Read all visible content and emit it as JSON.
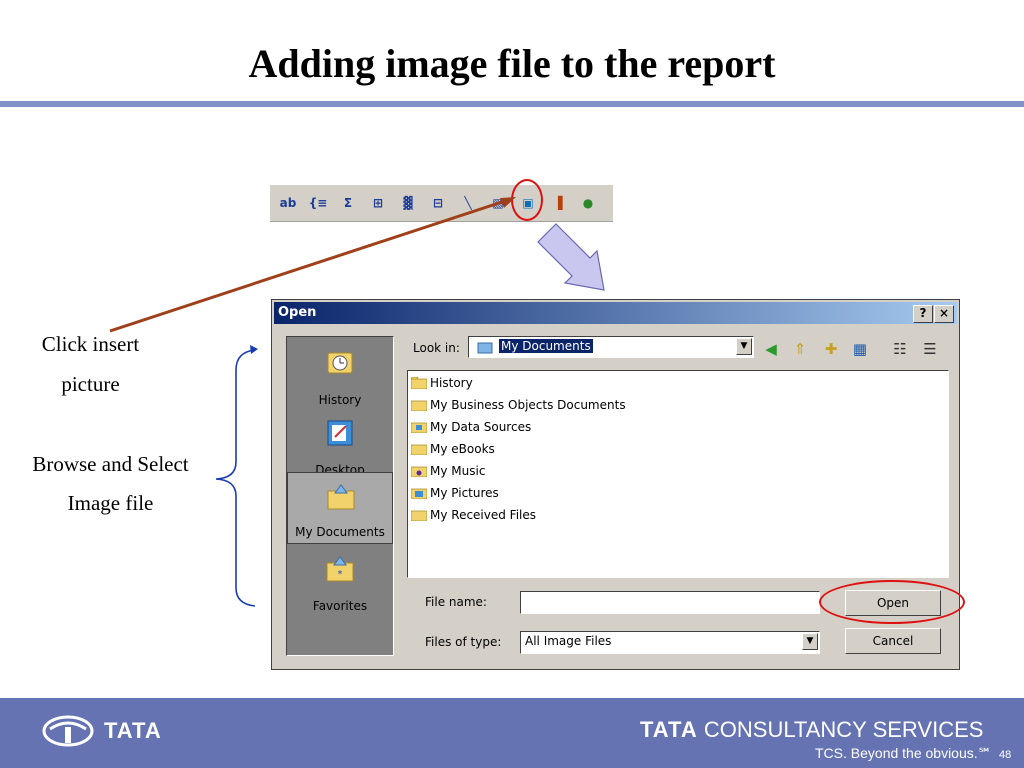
{
  "slide": {
    "title": "Adding image file to the report"
  },
  "annotations": {
    "click_insert_line1": "Click insert",
    "click_insert_line2": "picture",
    "browse_line1": "Browse and Select",
    "browse_line2": "Image file"
  },
  "toolbar": {
    "buttons": [
      "ab",
      "{≡",
      "Σ",
      "⊞",
      "▓",
      "⊟",
      "╲",
      "▧",
      "▣",
      "▐",
      "●"
    ]
  },
  "dialog": {
    "title": "Open",
    "help_label": "?",
    "close_label": "×",
    "places": [
      {
        "label": "History",
        "icon": "history-icon"
      },
      {
        "label": "Desktop",
        "icon": "desktop-icon"
      },
      {
        "label": "My Documents",
        "icon": "my-documents-icon",
        "selected": true
      },
      {
        "label": "Favorites",
        "icon": "favorites-icon"
      }
    ],
    "look_in_label": "Look in:",
    "look_in_value": "My Documents",
    "files": [
      {
        "name": "History",
        "icon": "folder-icon"
      },
      {
        "name": "My Business Objects Documents",
        "icon": "folder-icon"
      },
      {
        "name": "My Data Sources",
        "icon": "data-sources-folder-icon"
      },
      {
        "name": "My eBooks",
        "icon": "folder-icon"
      },
      {
        "name": "My Music",
        "icon": "music-folder-icon"
      },
      {
        "name": "My Pictures",
        "icon": "pictures-folder-icon"
      },
      {
        "name": "My Received Files",
        "icon": "folder-icon"
      }
    ],
    "file_name_label": "File name:",
    "file_name_value": "",
    "file_type_label": "Files of type:",
    "file_type_value": "All Image Files",
    "open_label": "Open",
    "cancel_label": "Cancel"
  },
  "footer": {
    "tata_logo": "TATA",
    "tcs_bold": "TATA",
    "tcs_rest": " CONSULTANCY SERVICES",
    "tagline": "TCS. Beyond the obvious.℠",
    "page_number": "48"
  },
  "colors": {
    "title_rule": "#8391c9",
    "footer": "#6573b3",
    "highlight": "#d11111",
    "arrow": "#a0401a",
    "brace": "#1a3cb0"
  }
}
